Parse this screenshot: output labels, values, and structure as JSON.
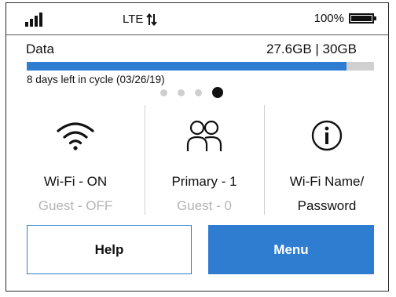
{
  "status": {
    "signal_bars": 4,
    "network": "LTE",
    "battery_text": "100%",
    "battery_level": 1.0
  },
  "data": {
    "label": "Data",
    "usage": "27.6GB | 30GB",
    "used_fraction": 0.92,
    "cycle_text": "8 days left in cycle (03/26/19)"
  },
  "pager": {
    "count": 4,
    "active_index": 3
  },
  "tiles": [
    {
      "icon": "wifi-icon",
      "line1": "Wi-Fi - ON",
      "line2": "Guest - OFF"
    },
    {
      "icon": "users-icon",
      "line1": "Primary - 1",
      "line2": "Guest - 0"
    },
    {
      "icon": "info-icon",
      "line1": "Wi-Fi Name/",
      "line2": "Password"
    }
  ],
  "buttons": {
    "help": "Help",
    "menu": "Menu"
  },
  "colors": {
    "accent": "#2e7dd1",
    "track": "#d0d0d0",
    "muted_text": "#b4b4b4"
  }
}
